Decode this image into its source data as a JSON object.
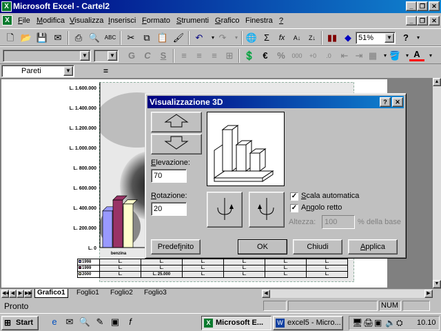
{
  "app": {
    "title": "Microsoft Excel - Cartel2",
    "icon_label": "X"
  },
  "menu": [
    {
      "label": "File",
      "u": "F",
      "rest": "ile"
    },
    {
      "label": "Modifica",
      "u": "M",
      "rest": "odifica"
    },
    {
      "label": "Visualizza",
      "u": "V",
      "rest": "isualizza"
    },
    {
      "label": "Inserisci",
      "u": "I",
      "rest": "nserisci"
    },
    {
      "label": "Formato",
      "u": "F",
      "rest": "ormato"
    },
    {
      "label": "Strumenti",
      "u": "S",
      "rest": "trumenti"
    },
    {
      "label": "Grafico",
      "u": "G",
      "rest": "rafico"
    },
    {
      "label": "Finestra",
      "u": "F",
      "rest": "inestra",
      "prefix": "Fi"
    },
    {
      "label": "?",
      "u": "?",
      "rest": ""
    }
  ],
  "toolbar": {
    "zoom": "51%",
    "bold": "G",
    "italic": "C",
    "underline": "S",
    "euro": "€",
    "percent": "%",
    "sum": "Σ",
    "fx": "fx"
  },
  "formula_bar": {
    "name_box": "Pareti",
    "equals": "="
  },
  "chart": {
    "y_ticks": [
      "L. 1.600.000",
      "L. 1.400.000",
      "L. 1.200.000",
      "L. 1.000.000",
      "L. 800.000",
      "L. 600.000",
      "L. 400.000",
      "L. 200.000",
      "L. 0"
    ],
    "category": "benzina",
    "rows": [
      {
        "label": "1998",
        "cells": [
          "L.",
          "L.",
          "L.",
          "L.",
          "L.",
          "L."
        ]
      },
      {
        "label": "1999",
        "cells": [
          "L.",
          "L.",
          "L.",
          "L.",
          "L.",
          "L."
        ]
      },
      {
        "label": "2000",
        "cells": [
          "L.",
          "L. 25.000",
          "L.",
          "L.",
          "L.",
          "L."
        ]
      }
    ],
    "series_colors": [
      "#9999ff",
      "#993366",
      "#ffffcc"
    ]
  },
  "chart_data": {
    "type": "bar",
    "categories": [
      "benzina"
    ],
    "series": [
      {
        "name": "1998",
        "values": [
          370000
        ]
      },
      {
        "name": "1999",
        "values": [
          480000
        ]
      },
      {
        "name": "2000",
        "values": [
          440000
        ]
      }
    ],
    "ylim": [
      0,
      1600000
    ]
  },
  "dialog": {
    "title": "Visualizzazione 3D",
    "help": "?",
    "close": "✕",
    "elevation_label": "Elevazione:",
    "elevation_u": "E",
    "elevation_rest": "levazione:",
    "elevation_value": "70",
    "rotation_label": "Rotazione:",
    "rotation_u": "R",
    "rotation_rest": "otazione:",
    "rotation_value": "20",
    "autoscale_u": "S",
    "autoscale_rest": "cala automatica",
    "rightangle_prefix": "A",
    "rightangle_u": "n",
    "rightangle_rest": "golo retto",
    "height_label": "Altezza:",
    "height_value": "100",
    "height_suffix": "% della base",
    "btn_default_prefix": "Predef",
    "btn_default_u": "i",
    "btn_default_rest": "nito",
    "btn_ok": "OK",
    "btn_close": "Chiudi",
    "btn_apply_u": "A",
    "btn_apply_rest": "pplica"
  },
  "tabs": [
    {
      "label": "Grafico1",
      "active": true
    },
    {
      "label": "Foglio1"
    },
    {
      "label": "Foglio2"
    },
    {
      "label": "Foglio3"
    }
  ],
  "status": {
    "text": "Pronto",
    "num": "NUM"
  },
  "taskbar": {
    "start": "Start",
    "tasks": [
      "Microsoft E...",
      "excel5 - Micro..."
    ],
    "clock": "10.10"
  }
}
